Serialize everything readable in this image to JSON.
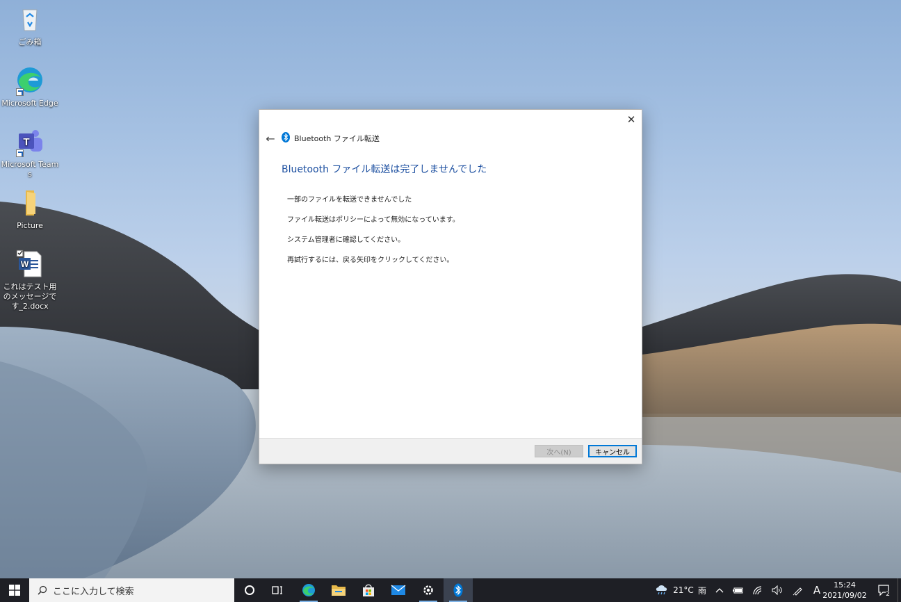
{
  "desktop": {
    "icons": [
      {
        "label": "ごみ箱",
        "icon": "recycle-bin-icon"
      },
      {
        "label": "Microsoft Edge",
        "icon": "edge-icon"
      },
      {
        "label": "Microsoft Teams",
        "icon": "teams-icon"
      },
      {
        "label": "Picture",
        "icon": "folder-icon"
      },
      {
        "label": "これはテスト用のメッセージです_2.docx",
        "icon": "word-document-icon"
      }
    ]
  },
  "dialog": {
    "close_symbol": "✕",
    "back_symbol": "←",
    "wizard_title": "Bluetooth ファイル転送",
    "heading": "Bluetooth ファイル転送は完了しませんでした",
    "messages": [
      "一部のファイルを転送できませんでした",
      "ファイル転送はポリシーによって無効になっています。",
      "システム管理者に確認してください。",
      "再試行するには、戻る矢印をクリックしてください。"
    ],
    "next_label": "次へ(N)",
    "cancel_label": "キャンセル",
    "next_enabled": false
  },
  "taskbar": {
    "search_placeholder": "ここに入力して検索",
    "apps": [
      "edge-icon",
      "file-explorer-icon",
      "store-icon",
      "mail-icon",
      "settings-icon",
      "bluetooth-icon"
    ],
    "weather_temp": "21°C",
    "weather_text": "雨",
    "ime_mode": "A",
    "time": "15:24",
    "date": "2021/09/02",
    "notification_count": "2",
    "accent_color": "#0078d7"
  }
}
